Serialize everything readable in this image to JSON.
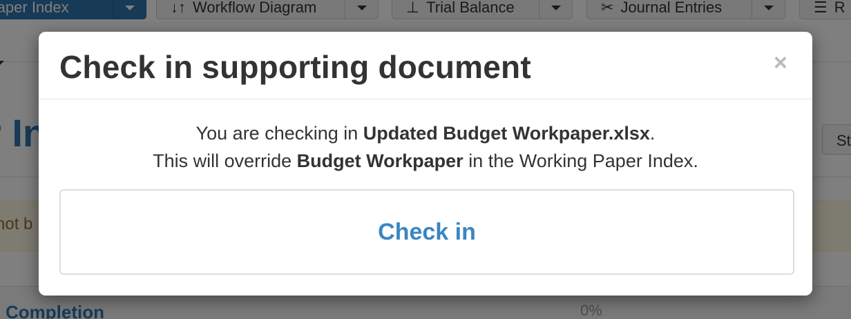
{
  "background": {
    "toolbar": [
      {
        "label": "Paper Index",
        "icon": "",
        "primary": true
      },
      {
        "label": "Workflow Diagram",
        "icon": "↓↑",
        "primary": false
      },
      {
        "label": "Trial Balance",
        "icon": "⊥",
        "primary": false
      },
      {
        "label": "Journal Entries",
        "icon": "✂",
        "primary": false
      },
      {
        "label": "R",
        "icon": "☰",
        "primary": false
      }
    ],
    "page_title_fragment": "r In",
    "right_button_fragment": "St",
    "alert_fragment": "not b",
    "completion_label": "Completion",
    "completion_percent": "0%"
  },
  "modal": {
    "title": "Check in supporting document",
    "close_icon": "×",
    "message": {
      "line1_prefix": "You are checking in ",
      "line1_file": "Updated Budget Workpaper.xlsx",
      "line1_suffix": ".",
      "line2_prefix": "This will override ",
      "line2_target": "Budget Workpaper",
      "line2_suffix": " in the Working Paper Index."
    },
    "checkin_button_label": "Check in"
  },
  "colors": {
    "accent": "#3a86c2",
    "primary_button": "#2e74ae",
    "title_text": "#333333",
    "backdrop": "rgba(0,0,0,0.5)"
  }
}
